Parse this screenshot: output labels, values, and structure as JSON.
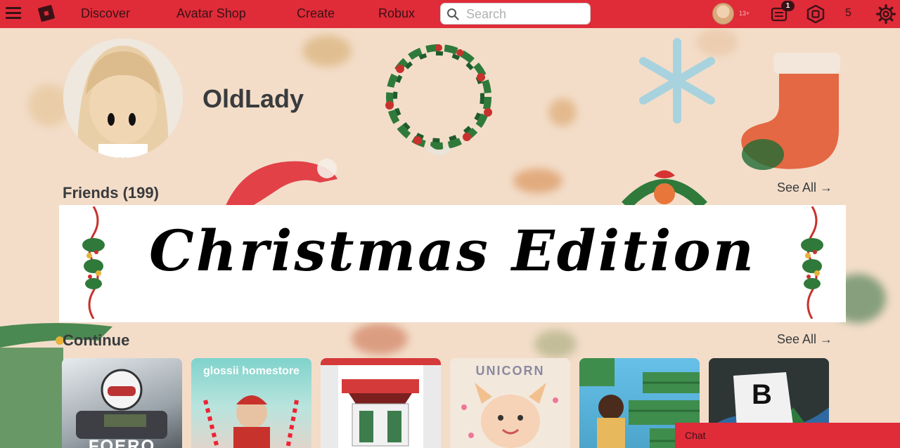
{
  "nav": {
    "links": [
      "Discover",
      "Avatar Shop",
      "Create",
      "Robux"
    ],
    "search_placeholder": "Search",
    "age_label": "13+",
    "notification_count": "1",
    "robux_count": "5"
  },
  "profile": {
    "username": "OldLady"
  },
  "friends": {
    "title": "Friends (199)",
    "see_all": "See All →"
  },
  "banner": {
    "text": "Christmas Edition"
  },
  "continue_section": {
    "title": "Continue",
    "see_all": "See All →",
    "tiles": [
      {
        "label": "FOERO"
      },
      {
        "label": "glossii homestore"
      },
      {
        "label": ""
      },
      {
        "label": "UNICORN"
      },
      {
        "label": ""
      },
      {
        "label": "B"
      }
    ]
  },
  "chat": {
    "label": "Chat"
  },
  "colors": {
    "nav_bg": "#e02b39",
    "nav_text": "#3a1216",
    "page_bg": "#f3ddc9",
    "text_dark": "#393b3d"
  },
  "icons": [
    "hamburger-icon",
    "roblox-logo",
    "search-icon",
    "notifications-icon",
    "robux-icon",
    "gear-icon"
  ]
}
